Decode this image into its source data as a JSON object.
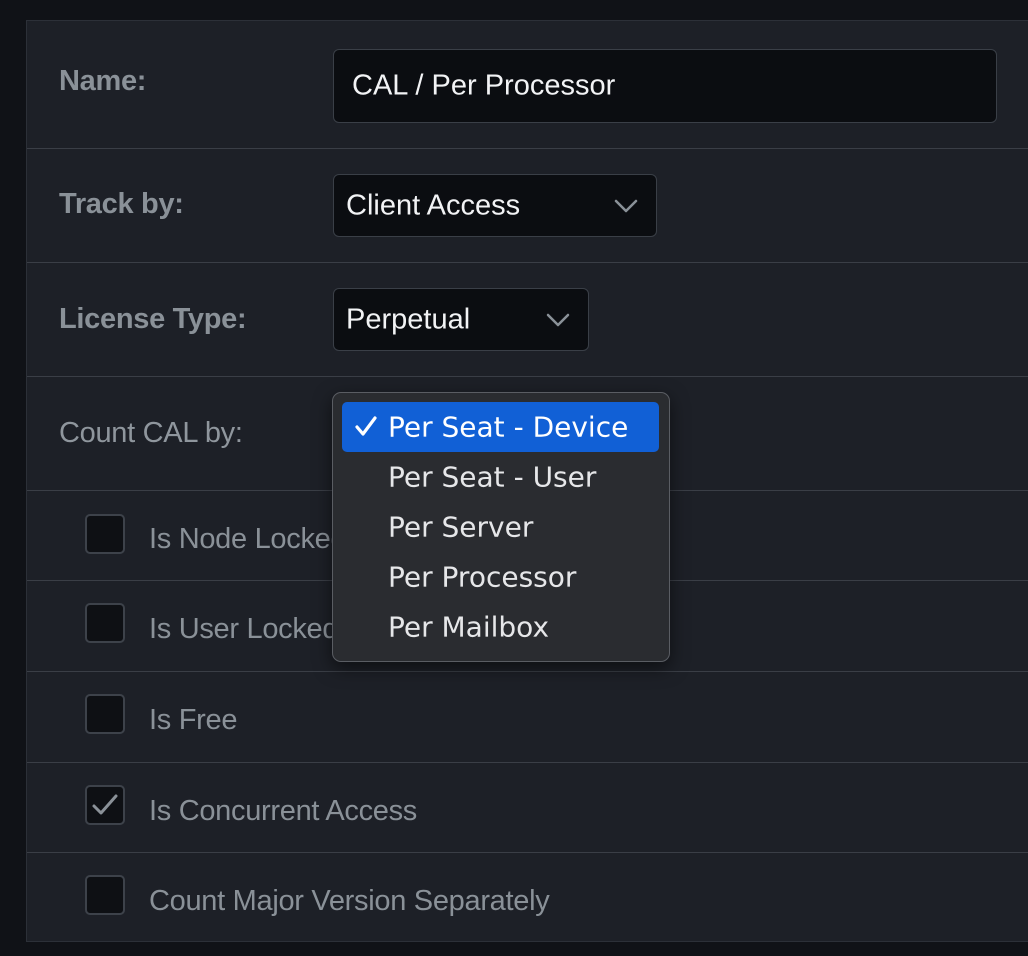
{
  "form": {
    "name": {
      "label": "Name:",
      "value": "CAL / Per Processor"
    },
    "track_by": {
      "label": "Track by:",
      "value": "Client Access"
    },
    "license_type": {
      "label": "License Type:",
      "value": "Perpetual"
    },
    "count_cal_by": {
      "label": "Count CAL by:",
      "selected": "Per Seat - Device",
      "options": [
        "Per Seat - Device",
        "Per Seat - User",
        "Per Server",
        "Per Processor",
        "Per Mailbox"
      ]
    },
    "checkboxes": [
      {
        "label": "Is Node Locked",
        "checked": false
      },
      {
        "label": "Is User Locked",
        "checked": false
      },
      {
        "label": "Is Free",
        "checked": false
      },
      {
        "label": "Is Concurrent Access",
        "checked": true
      },
      {
        "label": "Count Major Version Separately",
        "checked": false
      }
    ]
  },
  "colors": {
    "panel_bg": "#1d2027",
    "field_bg": "#0b0d11",
    "label_text": "#8a9198",
    "menu_bg": "#2a2c30",
    "menu_selected": "#1160d6"
  },
  "icons": {
    "dropdown": "chevron-down-icon",
    "selected_option": "checkmark-icon",
    "checked_box": "checkmark-icon"
  }
}
